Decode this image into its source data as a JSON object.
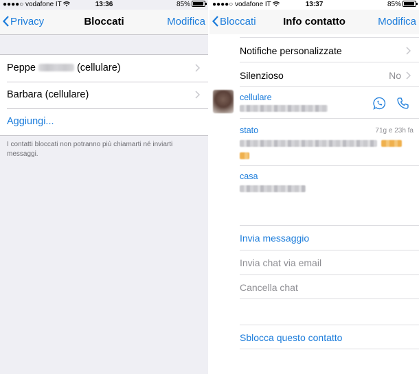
{
  "left": {
    "status": {
      "carrier": "●●●●○ vodafone IT",
      "time": "13:36",
      "battery": "85%"
    },
    "nav": {
      "back": "Privacy",
      "title": "Bloccati",
      "action": "Modifica"
    },
    "contacts": [
      {
        "first": "Peppe",
        "suffix": "(cellulare)"
      },
      {
        "first": "Barbara (cellulare)",
        "suffix": ""
      }
    ],
    "add_label": "Aggiungi...",
    "footnote": "I contatti bloccati non potranno più chiamarti né inviarti messaggi."
  },
  "right": {
    "status": {
      "carrier": "●●●●○ vodafone IT",
      "time": "13:37",
      "battery": "85%"
    },
    "nav": {
      "back": "Bloccati",
      "title": "Info contatto",
      "action": "Modifica"
    },
    "rows": {
      "notifications": "Notifiche personalizzate",
      "mute": "Silenzioso",
      "mute_value": "No"
    },
    "phone_label": "cellulare",
    "status_label": "stato",
    "status_time": "71g e 23h fa",
    "home_label": "casa",
    "actions": {
      "send_message": "Invia messaggio",
      "email_chat": "Invia chat via email",
      "clear_chat": "Cancella chat",
      "unblock": "Sblocca questo contatto"
    },
    "icons": {
      "whatsapp": "whatsapp-icon",
      "call": "phone-icon"
    },
    "accent": "#1b7cdb"
  }
}
